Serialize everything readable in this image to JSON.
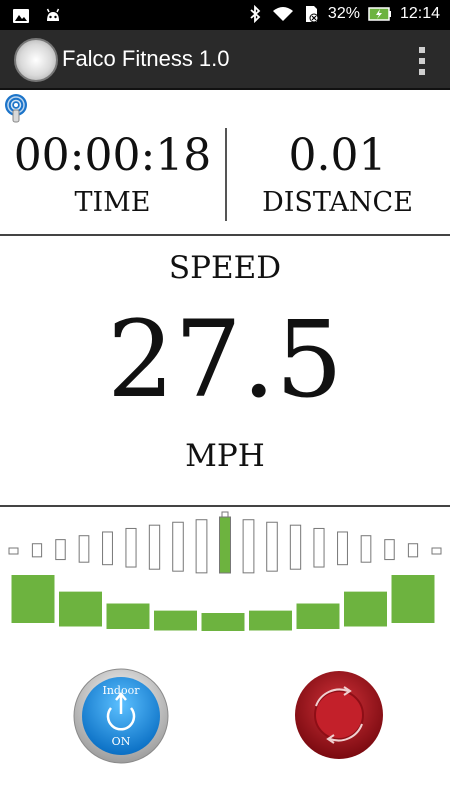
{
  "statusbar": {
    "battery": "32%",
    "time": "12:14",
    "icons": [
      "gallery-icon",
      "android-icon",
      "bluetooth-icon",
      "wifi-icon",
      "sim-icon",
      "battery-charging-icon"
    ]
  },
  "appbar": {
    "title": "Falco Fitness 1.0",
    "logo_icon": "app-logo-icon",
    "menu_icon": "overflow-menu-icon"
  },
  "connection_icon": "bluetooth-connection-icon",
  "metrics": {
    "time_value": "00:00:18",
    "time_label": "TIME",
    "distance_value": "0.01",
    "distance_label": "DISTANCE"
  },
  "speed": {
    "label": "SPEED",
    "value": "27.5",
    "unit": "MPH"
  },
  "gauge": {
    "segments": 19,
    "active_segment": 9,
    "level_fraction": 0.5,
    "level_bars": 9,
    "active_color": "#6db33f",
    "outline_color": "#777777"
  },
  "buttons": {
    "mode_top": "Indoor",
    "mode_bottom": "ON",
    "mode_color": "#1c8fe0",
    "stop_color": "#b3121a"
  }
}
